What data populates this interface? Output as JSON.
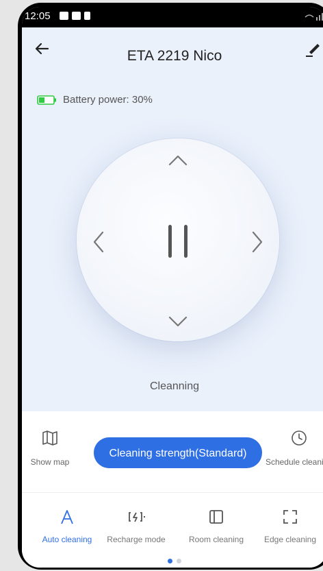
{
  "status_bar": {
    "time": "12:05"
  },
  "header": {
    "title": "ETA 2219 Nico"
  },
  "battery": {
    "label": "Battery power: 30%",
    "level": 0.3
  },
  "control": {
    "status": "Cleanning"
  },
  "actions": {
    "show_map": "Show map",
    "strength": "Cleaning strength(Standard)",
    "schedule": "Schedule cleaning"
  },
  "modes": [
    {
      "label": "Auto cleaning",
      "icon": "letter-a-icon",
      "active": true
    },
    {
      "label": "Recharge mode",
      "icon": "recharge-icon",
      "active": false
    },
    {
      "label": "Room cleaning",
      "icon": "room-icon",
      "active": false
    },
    {
      "label": "Edge cleaning",
      "icon": "edge-icon",
      "active": false
    }
  ],
  "pager": {
    "pages": 2,
    "current": 1
  },
  "colors": {
    "accent": "#2f6fe4",
    "battery": "#2ecc40",
    "background": "#eaf1fb"
  }
}
